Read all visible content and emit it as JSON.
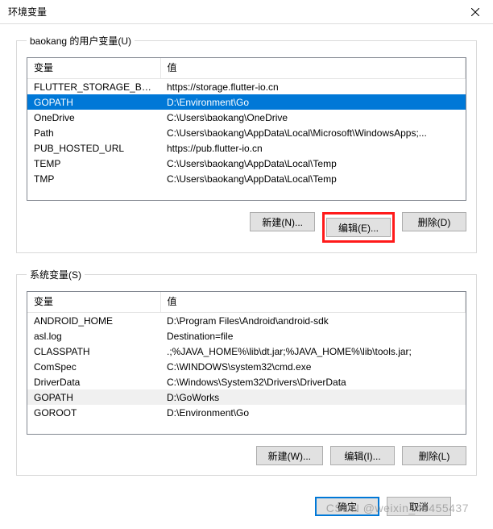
{
  "window": {
    "title": "环境变量"
  },
  "user_section": {
    "legend": "baokang 的用户变量(U)",
    "headers": {
      "name": "变量",
      "value": "值"
    },
    "rows": [
      {
        "name": "FLUTTER_STORAGE_BASE_...",
        "value": "https://storage.flutter-io.cn",
        "selected": false
      },
      {
        "name": "GOPATH",
        "value": "D:\\Environment\\Go",
        "selected": true
      },
      {
        "name": "OneDrive",
        "value": "C:\\Users\\baokang\\OneDrive",
        "selected": false
      },
      {
        "name": "Path",
        "value": "C:\\Users\\baokang\\AppData\\Local\\Microsoft\\WindowsApps;...",
        "selected": false
      },
      {
        "name": "PUB_HOSTED_URL",
        "value": "https://pub.flutter-io.cn",
        "selected": false
      },
      {
        "name": "TEMP",
        "value": "C:\\Users\\baokang\\AppData\\Local\\Temp",
        "selected": false
      },
      {
        "name": "TMP",
        "value": "C:\\Users\\baokang\\AppData\\Local\\Temp",
        "selected": false
      }
    ],
    "buttons": {
      "new": "新建(N)...",
      "edit": "编辑(E)...",
      "delete": "删除(D)"
    }
  },
  "system_section": {
    "legend": "系统变量(S)",
    "headers": {
      "name": "变量",
      "value": "值"
    },
    "rows": [
      {
        "name": "ANDROID_HOME",
        "value": "D:\\Program Files\\Android\\android-sdk"
      },
      {
        "name": "asl.log",
        "value": "Destination=file"
      },
      {
        "name": "CLASSPATH",
        "value": ".;%JAVA_HOME%\\lib\\dt.jar;%JAVA_HOME%\\lib\\tools.jar;"
      },
      {
        "name": "ComSpec",
        "value": "C:\\WINDOWS\\system32\\cmd.exe"
      },
      {
        "name": "DriverData",
        "value": "C:\\Windows\\System32\\Drivers\\DriverData"
      },
      {
        "name": "GOPATH",
        "value": "D:\\GoWorks",
        "highlight": true
      },
      {
        "name": "GOROOT",
        "value": "D:\\Environment\\Go"
      }
    ],
    "buttons": {
      "new": "新建(W)...",
      "edit": "编辑(I)...",
      "delete": "删除(L)"
    }
  },
  "dialog_buttons": {
    "ok": "确定",
    "cancel": "取消"
  },
  "watermark": "CSDN @weixin_40455437"
}
